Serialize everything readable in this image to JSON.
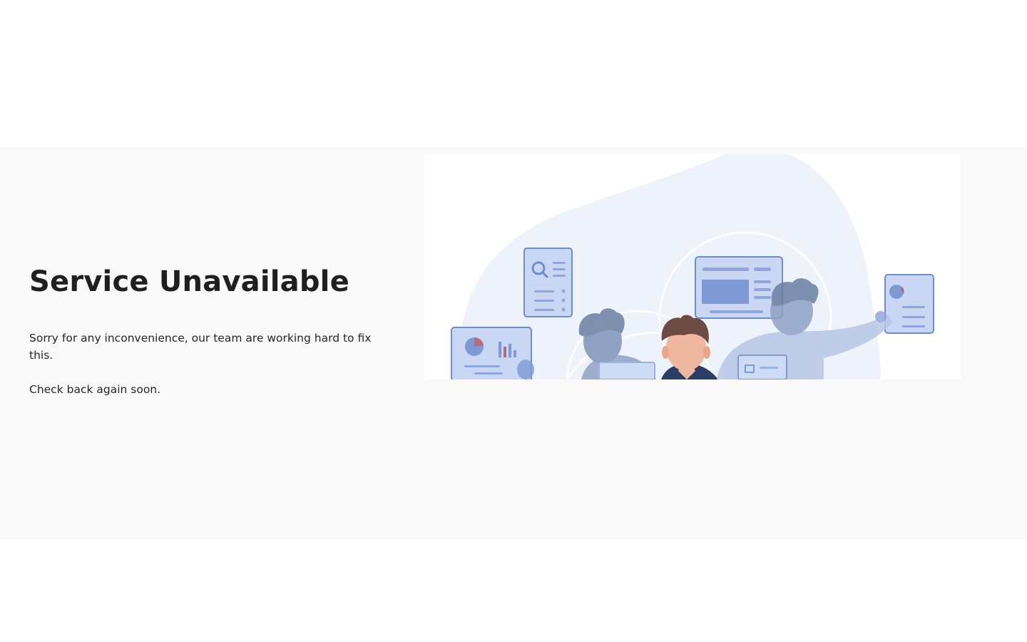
{
  "page": {
    "title": "Service Unavailable",
    "message": "Sorry for any inconvenience, our team are working hard to fix this.",
    "followup": "Check back again soon."
  },
  "illustration": {
    "name": "team-working-illustration",
    "colors": {
      "blob": "#eef2fb",
      "card_fill": "#c9d7f5",
      "card_stroke": "#6f8dc6",
      "accent": "#9aafe0",
      "person_hair": "#6b7fa3",
      "center_hair": "#6e4b42",
      "center_skin": "#f0b7a0",
      "center_shirt": "#2c3e63",
      "chart_red": "#b86a7e"
    }
  }
}
